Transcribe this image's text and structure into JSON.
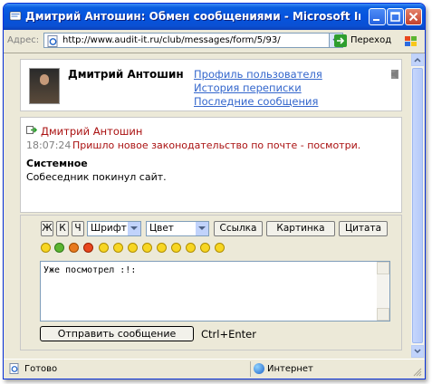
{
  "window": {
    "title": "Дмитрий Антошин: Обмен сообщениями - Microsoft Inter...",
    "minimize_icon": "minimize-icon",
    "maximize_icon": "maximize-icon",
    "close_icon": "close-icon"
  },
  "address_bar": {
    "label": "Адрес:",
    "url": "http://www.audit-it.ru/club/messages/form/5/93/",
    "go_label": "Переход"
  },
  "profile": {
    "name": "Дмитрий Антошин",
    "links": [
      "Профиль пользователя",
      "История переписки",
      "Последние сообщения"
    ]
  },
  "messages": {
    "author": "Дмитрий Антошин",
    "time": "18:07:24",
    "text": "Пришло новое законодательство по почте - посмотри.",
    "system_title": "Системное",
    "system_text": "Собеседник покинул сайт."
  },
  "editor": {
    "bold_label": "Ж",
    "italic_label": "К",
    "underline_label": "Ч",
    "font_select": "Шрифт",
    "color_select": "Цвет",
    "link_button": "Ссылка",
    "image_button": "Картинка",
    "quote_button": "Цитата",
    "smileys": [
      "smile",
      "up",
      "question",
      "exclaim",
      "wink",
      "sad",
      "frown",
      "laugh",
      "cool",
      "angry",
      "grin",
      "happy",
      "blush"
    ],
    "text_value": "Уже посмотрел :!:",
    "send_button": "Отправить сообщение",
    "hotkey_hint": "Ctrl+Enter"
  },
  "statusbar": {
    "status": "Готово",
    "zone": "Интернет"
  },
  "colors": {
    "titlebar": "#0553DE",
    "link": "#3366CC",
    "message_red": "#AA1111"
  }
}
